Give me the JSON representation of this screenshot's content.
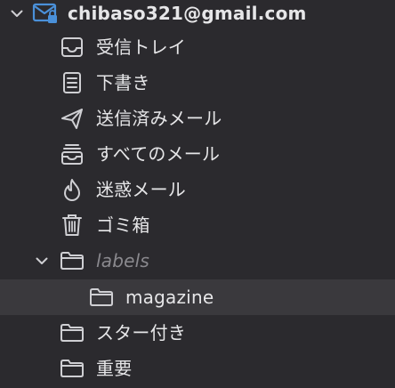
{
  "account": {
    "email": "chibaso321@gmail.com",
    "icon": "envelope-lock-icon"
  },
  "mailboxes": [
    {
      "label": "受信トレイ",
      "icon": "inbox-tray-icon"
    },
    {
      "label": "下書き",
      "icon": "draft-document-icon"
    },
    {
      "label": "送信済みメール",
      "icon": "paper-plane-icon"
    },
    {
      "label": "すべてのメール",
      "icon": "archive-box-icon"
    },
    {
      "label": "迷惑メール",
      "icon": "flame-junk-icon"
    },
    {
      "label": "ゴミ箱",
      "icon": "trash-icon"
    }
  ],
  "labels_group": {
    "label": "labels",
    "icon": "folder-icon",
    "children": [
      {
        "label": "magazine",
        "icon": "folder-icon"
      }
    ]
  },
  "folders": [
    {
      "label": "スター付き",
      "icon": "folder-icon"
    },
    {
      "label": "重要",
      "icon": "folder-icon"
    }
  ],
  "colors": {
    "background": "#2b2a2e",
    "selected_row": "#3a393d",
    "icon": "#cfcfd3",
    "accent_blue": "#4a90d9",
    "muted_text": "#8a898e"
  }
}
